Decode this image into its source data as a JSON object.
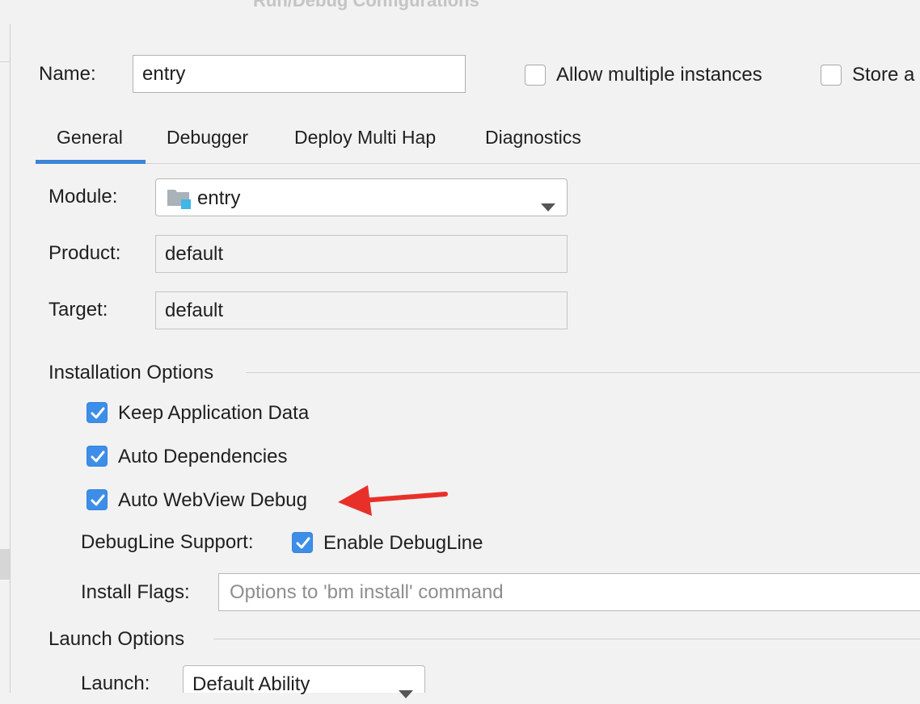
{
  "window": {
    "title": "Run/Debug Configurations"
  },
  "header": {
    "name_label": "Name:",
    "name_value": "entry",
    "allow_multiple_label": "Allow multiple instances",
    "allow_multiple_checked": false,
    "store_label": "Store a",
    "store_checked": false
  },
  "tabs": [
    {
      "label": "General",
      "active": true
    },
    {
      "label": "Debugger",
      "active": false
    },
    {
      "label": "Deploy Multi Hap",
      "active": false
    },
    {
      "label": "Diagnostics",
      "active": false
    }
  ],
  "general": {
    "module_label": "Module:",
    "module_value": "entry",
    "module_icon": "module-folder-icon",
    "product_label": "Product:",
    "product_value": "default",
    "target_label": "Target:",
    "target_value": "default"
  },
  "installation": {
    "section_title": "Installation Options",
    "keep_app_data_label": "Keep Application Data",
    "keep_app_data_checked": true,
    "auto_dependencies_label": "Auto Dependencies",
    "auto_dependencies_checked": true,
    "auto_webview_label": "Auto WebView Debug",
    "auto_webview_checked": true,
    "debugline_label": "DebugLine Support:",
    "enable_debugline_label": "Enable DebugLine",
    "enable_debugline_checked": true,
    "install_flags_label": "Install Flags:",
    "install_flags_placeholder": "Options to 'bm install' command",
    "install_flags_value": ""
  },
  "launch": {
    "section_title": "Launch Options",
    "launch_label": "Launch:",
    "launch_value": "Default Ability"
  },
  "annotation": {
    "arrow_color": "#e8302a"
  },
  "colors": {
    "accent": "#3b85d6",
    "checkbox_checked": "#3d8ee8",
    "background": "#f2f2f2"
  }
}
